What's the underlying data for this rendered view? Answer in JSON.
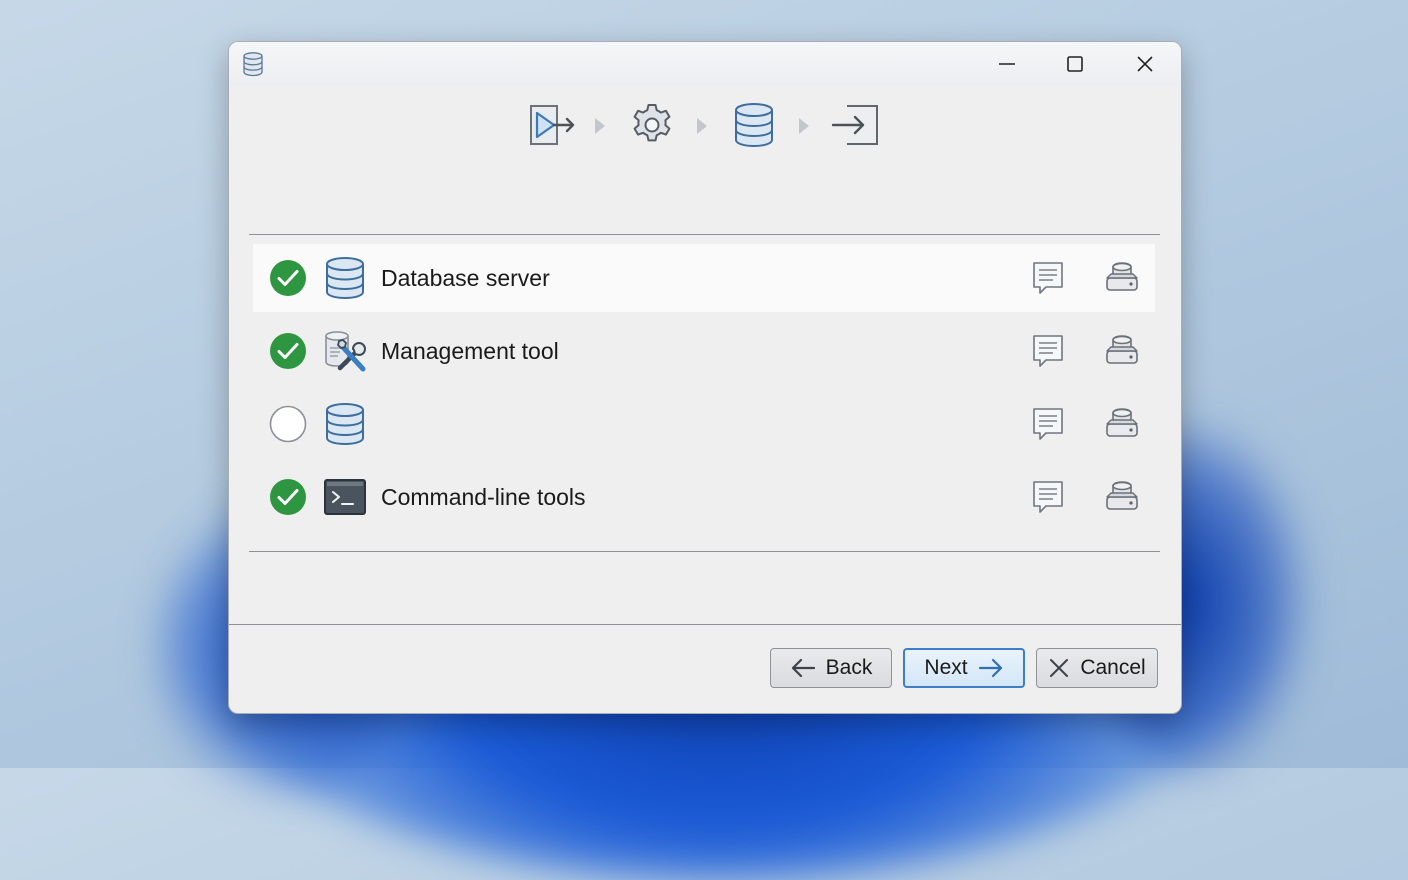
{
  "window": {
    "app_icon": "database-icon",
    "controls": [
      "minimize-icon",
      "maximize-icon",
      "close-icon"
    ]
  },
  "steps": [
    {
      "icon": "start-arrow-icon",
      "state": "done"
    },
    {
      "icon": "gear-icon",
      "state": "done"
    },
    {
      "icon": "database-icon",
      "state": "current"
    },
    {
      "icon": "finish-exit-icon",
      "state": "pending"
    }
  ],
  "components": [
    {
      "label": "Database server",
      "checked": true,
      "icon": "database-icon",
      "selected": true
    },
    {
      "label": "Management tool",
      "checked": true,
      "icon": "tools-icon",
      "selected": false
    },
    {
      "label": "",
      "checked": false,
      "icon": "database-icon",
      "selected": false
    },
    {
      "label": "Command-line tools",
      "checked": true,
      "icon": "terminal-icon",
      "selected": false
    }
  ],
  "footer": {
    "back_label": "Back",
    "next_label": "Next",
    "cancel_label": "Cancel"
  },
  "colors": {
    "check_green": "#2e9640",
    "accent_blue": "#3c7fc6",
    "icon_blue": "#5e86b0"
  }
}
